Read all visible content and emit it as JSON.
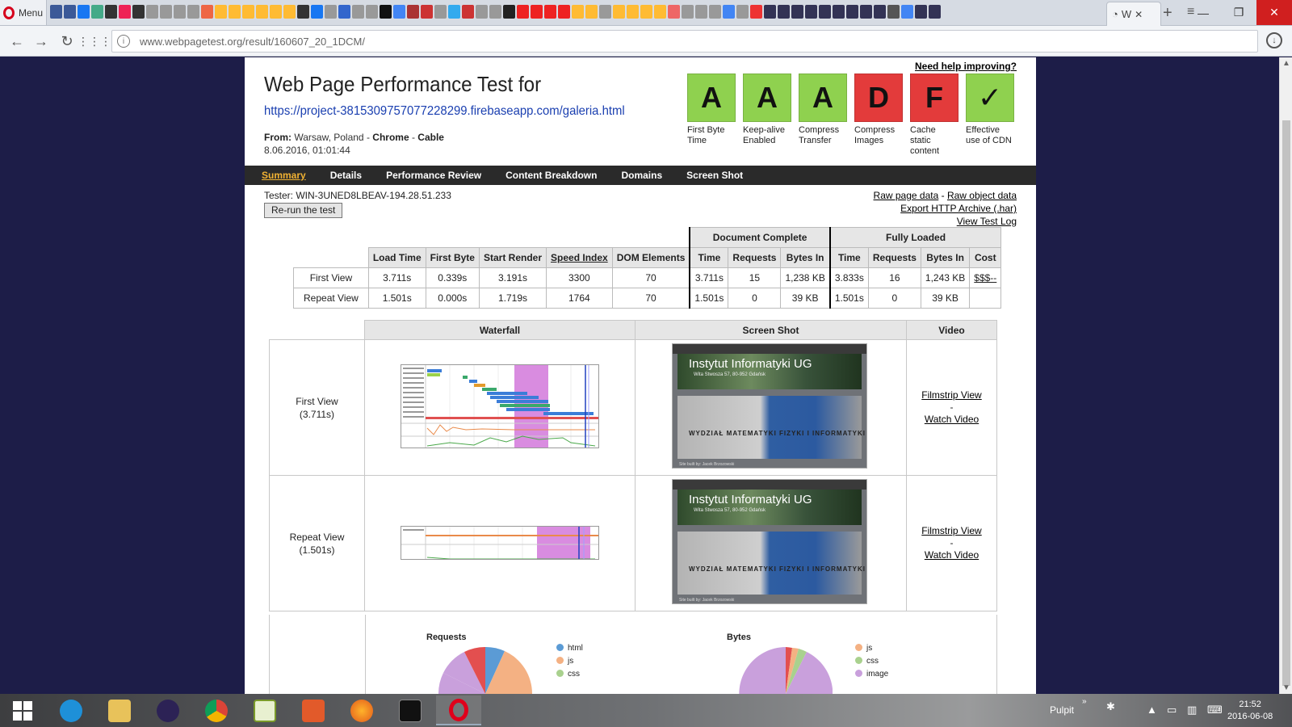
{
  "browser": {
    "menu_label": "Menu",
    "active_tab_label": "W",
    "url": "www.webpagetest.org/result/160607_20_1DCM/"
  },
  "page": {
    "help_link": "Need help improving?",
    "title": "Web Page Performance Test for",
    "test_url": "https://project-3815309757077228299.firebaseapp.com/galeria.html",
    "from_label": "From:",
    "from_location": "Warsaw, Poland",
    "from_browser": "Chrome",
    "from_connection": "Cable",
    "sep": " - ",
    "date": "8.06.2016, 01:01:44",
    "grades": [
      {
        "grade": "A",
        "label": "First Byte Time",
        "color": "#8fd14f"
      },
      {
        "grade": "A",
        "label": "Keep-alive Enabled",
        "color": "#8fd14f"
      },
      {
        "grade": "A",
        "label": "Compress Transfer",
        "color": "#8fd14f"
      },
      {
        "grade": "D",
        "label": "Compress Images",
        "color": "#e33b3b"
      },
      {
        "grade": "F",
        "label": "Cache static content",
        "color": "#e33b3b"
      },
      {
        "grade": "✓",
        "label": "Effective use of CDN",
        "color": "#8fd14f"
      }
    ],
    "nav": [
      "Summary",
      "Details",
      "Performance Review",
      "Content Breakdown",
      "Domains",
      "Screen Shot"
    ],
    "tester": "Tester: WIN-3UNED8LBEAV-194.28.51.233",
    "rerun_button": "Re-run the test",
    "raw_page_data": "Raw page data",
    "raw_object_data": "Raw object data",
    "export_har": "Export HTTP Archive (.har)",
    "view_log": "View Test Log",
    "results": {
      "group_doc": "Document Complete",
      "group_full": "Fully Loaded",
      "headers": [
        "Load Time",
        "First Byte",
        "Start Render",
        "Speed Index",
        "DOM Elements",
        "Time",
        "Requests",
        "Bytes In",
        "Time",
        "Requests",
        "Bytes In",
        "Cost"
      ],
      "rows": [
        {
          "label": "First View",
          "cells": [
            "3.711s",
            "0.339s",
            "3.191s",
            "3300",
            "70",
            "3.711s",
            "15",
            "1,238 KB",
            "3.833s",
            "16",
            "1,243 KB",
            "$$$--"
          ]
        },
        {
          "label": "Repeat View",
          "cells": [
            "1.501s",
            "0.000s",
            "1.719s",
            "1764",
            "70",
            "1.501s",
            "0",
            "39 KB",
            "1.501s",
            "0",
            "39 KB",
            ""
          ]
        }
      ]
    },
    "media": {
      "headers": [
        "Waterfall",
        "Screen Shot",
        "Video"
      ],
      "rows": [
        {
          "view": "First View",
          "time": "(3.711s)"
        },
        {
          "view": "Repeat View",
          "time": "(1.501s)"
        }
      ],
      "filmstrip": "Filmstrip View",
      "dash": "-",
      "watch": "Watch Video",
      "screenshot_title": "Instytut Informatyki UG",
      "screenshot_sub": "Wita Stwosza 57, 80-952 Gdańsk",
      "screenshot_facade": "WYDZIAŁ MATEMATYKI FIZYKI I INFORMATYKI",
      "screenshot_foot": "Site built by: Jacek Brzozowski"
    },
    "pies": {
      "requests_title": "Requests",
      "bytes_title": "Bytes",
      "requests_legend": [
        {
          "label": "html",
          "color": "#5b9bd5"
        },
        {
          "label": "js",
          "color": "#f4b183"
        },
        {
          "label": "css",
          "color": "#a9d18e"
        }
      ],
      "bytes_legend": [
        {
          "label": "js",
          "color": "#f4b183"
        },
        {
          "label": "css",
          "color": "#a9d18e"
        },
        {
          "label": "image",
          "color": "#c9a0dc"
        }
      ]
    }
  },
  "taskbar": {
    "pulpit": "Pulpit",
    "time": "21:52",
    "date": "2016-06-08"
  }
}
